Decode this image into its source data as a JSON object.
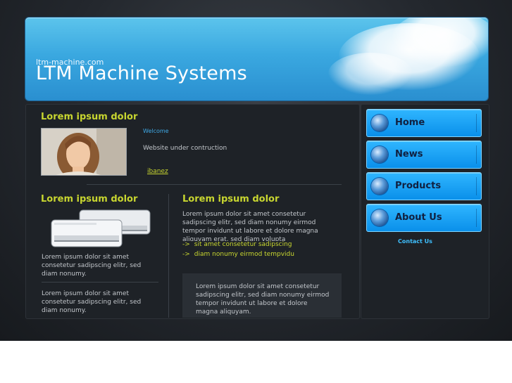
{
  "header": {
    "url": "ltm-machine.com",
    "title": "LTM Machine Systems"
  },
  "intro": {
    "heading": "Lorem ipsum dolor",
    "welcome": "Welcome",
    "status": "Website under contruction",
    "link": "ibanez"
  },
  "left_col": {
    "heading": "Lorem ipsum dolor",
    "para1": "Lorem ipsum dolor sit amet consetetur sadipscing elitr, sed diam nonumy.",
    "para2": "Lorem ipsum dolor sit amet consetetur sadipscing elitr, sed diam nonumy."
  },
  "right_col": {
    "heading": "Lorem ipsum dolor",
    "para": "Lorem ipsum dolor sit amet consetetur sadipscing elitr, sed diam nonumy eirmod tempor invidunt ut labore et dolore magna aliquyam erat, sed diam volupta",
    "links": [
      {
        "arrow": "->",
        "text": "sit amet consetetur sadipscing"
      },
      {
        "arrow": "->",
        "text": "diam nonumy eirmod tempvidu"
      }
    ],
    "quote": "Lorem ipsum dolor sit amet consetetur sadipscing elitr, sed diam nonumy eirmod tempor invidunt ut labore et dolore magna aliquyam."
  },
  "nav": {
    "items": [
      {
        "label": "Home"
      },
      {
        "label": "News"
      },
      {
        "label": "Products"
      },
      {
        "label": "About Us"
      }
    ],
    "contact": "Contact Us"
  },
  "colors": {
    "accent_yellow": "#c8d630",
    "accent_blue": "#3fa9e6",
    "nav_blue": "#0a90ea",
    "background": "#1e2227"
  }
}
